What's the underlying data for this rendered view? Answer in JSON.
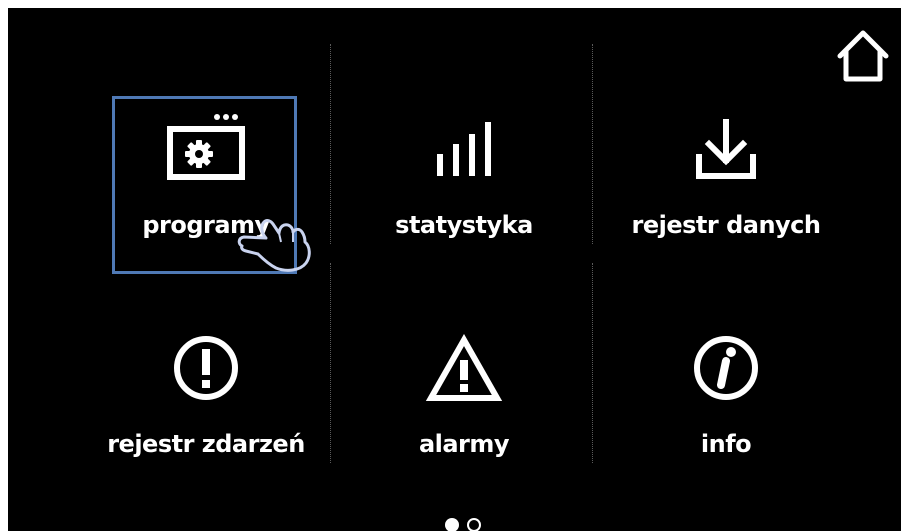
{
  "menu": {
    "tiles": [
      {
        "label": "programy",
        "icon": "program-icon"
      },
      {
        "label": "statystyka",
        "icon": "bar-chart-icon"
      },
      {
        "label": "rejestr danych",
        "icon": "download-icon"
      },
      {
        "label": "rejestr zdarzeń",
        "icon": "exclamation-circle-icon"
      },
      {
        "label": "alarmy",
        "icon": "warning-triangle-icon"
      },
      {
        "label": "info",
        "icon": "info-circle-icon"
      }
    ],
    "selected": "programy"
  },
  "pager": {
    "pages": 2,
    "current": 1
  },
  "colors": {
    "background": "#000000",
    "foreground": "#ffffff",
    "highlight": "#4f79b5",
    "hand": "#c9d3ef"
  },
  "icons": {
    "home": "home-icon",
    "pointer": "hand-pointer-icon"
  }
}
